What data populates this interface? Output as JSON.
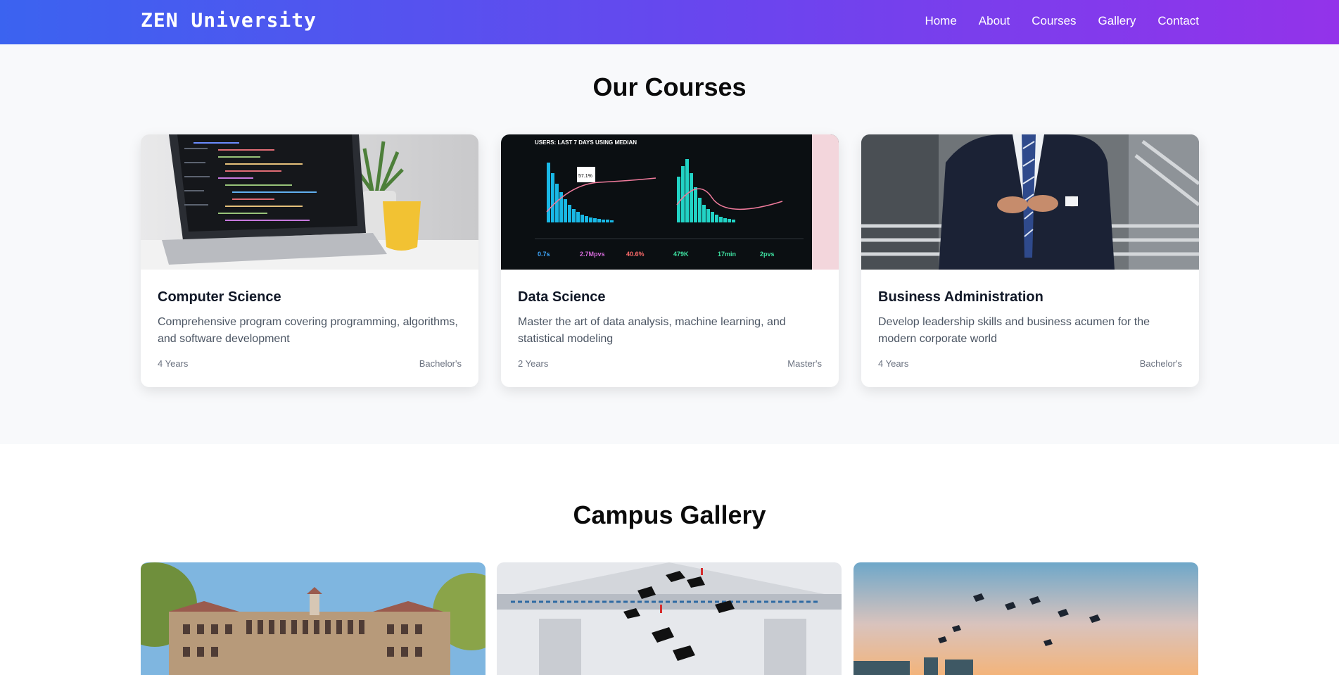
{
  "brand": "ZEN University",
  "nav": [
    "Home",
    "About",
    "Courses",
    "Gallery",
    "Contact"
  ],
  "courses": {
    "title": "Our Courses",
    "items": [
      {
        "name": "Computer Science",
        "description": "Comprehensive program covering programming, algorithms, and software development",
        "duration": "4 Years",
        "degree": "Bachelor's"
      },
      {
        "name": "Data Science",
        "description": "Master the art of data analysis, machine learning, and statistical modeling",
        "duration": "2 Years",
        "degree": "Master's",
        "image_text": {
          "header": "USERS: LAST 7 DAYS USING MEDIAN",
          "tooltip": "57.1%",
          "stats": [
            "0.7s",
            "2.7Mpvs",
            "40.6%",
            "479K",
            "17min",
            "2pvs"
          ]
        }
      },
      {
        "name": "Business Administration",
        "description": "Develop leadership skills and business acumen for the modern corporate world",
        "duration": "4 Years",
        "degree": "Bachelor's"
      }
    ]
  },
  "gallery": {
    "title": "Campus Gallery"
  },
  "colors": {
    "nav_gradient_start": "#3b63f0",
    "nav_gradient_end": "#9333ea",
    "section_bg": "#f8f9fb"
  }
}
